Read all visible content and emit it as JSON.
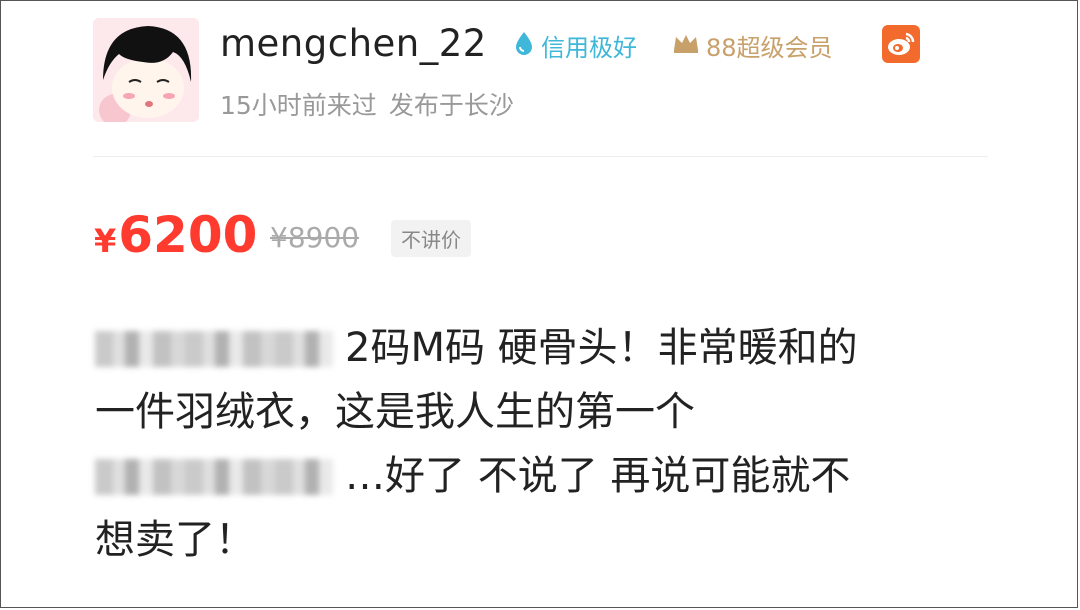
{
  "seller": {
    "username": "mengchen_22",
    "credit_badge": "信用极好",
    "vip_badge": "88超级会员",
    "last_seen": "15小时前来过",
    "location": "发布于长沙"
  },
  "pricing": {
    "currency": "¥",
    "price": "6200",
    "original_price": "¥8900",
    "tag": "不讲价"
  },
  "description": {
    "line1_text": "2码M码 硬骨头！非常暖和的",
    "line2_text": "一件羽绒衣，这是我人生的第一个",
    "line3_text": "…好了 不说了 再说可能就不",
    "line4_text": "想卖了！"
  },
  "colors": {
    "price": "#ff3b2f",
    "credit": "#3fb7d9",
    "vip": "#c8a06a",
    "weibo": "#f26b2d"
  },
  "icons": [
    "water-drop-icon",
    "crown-icon",
    "weibo-icon"
  ]
}
